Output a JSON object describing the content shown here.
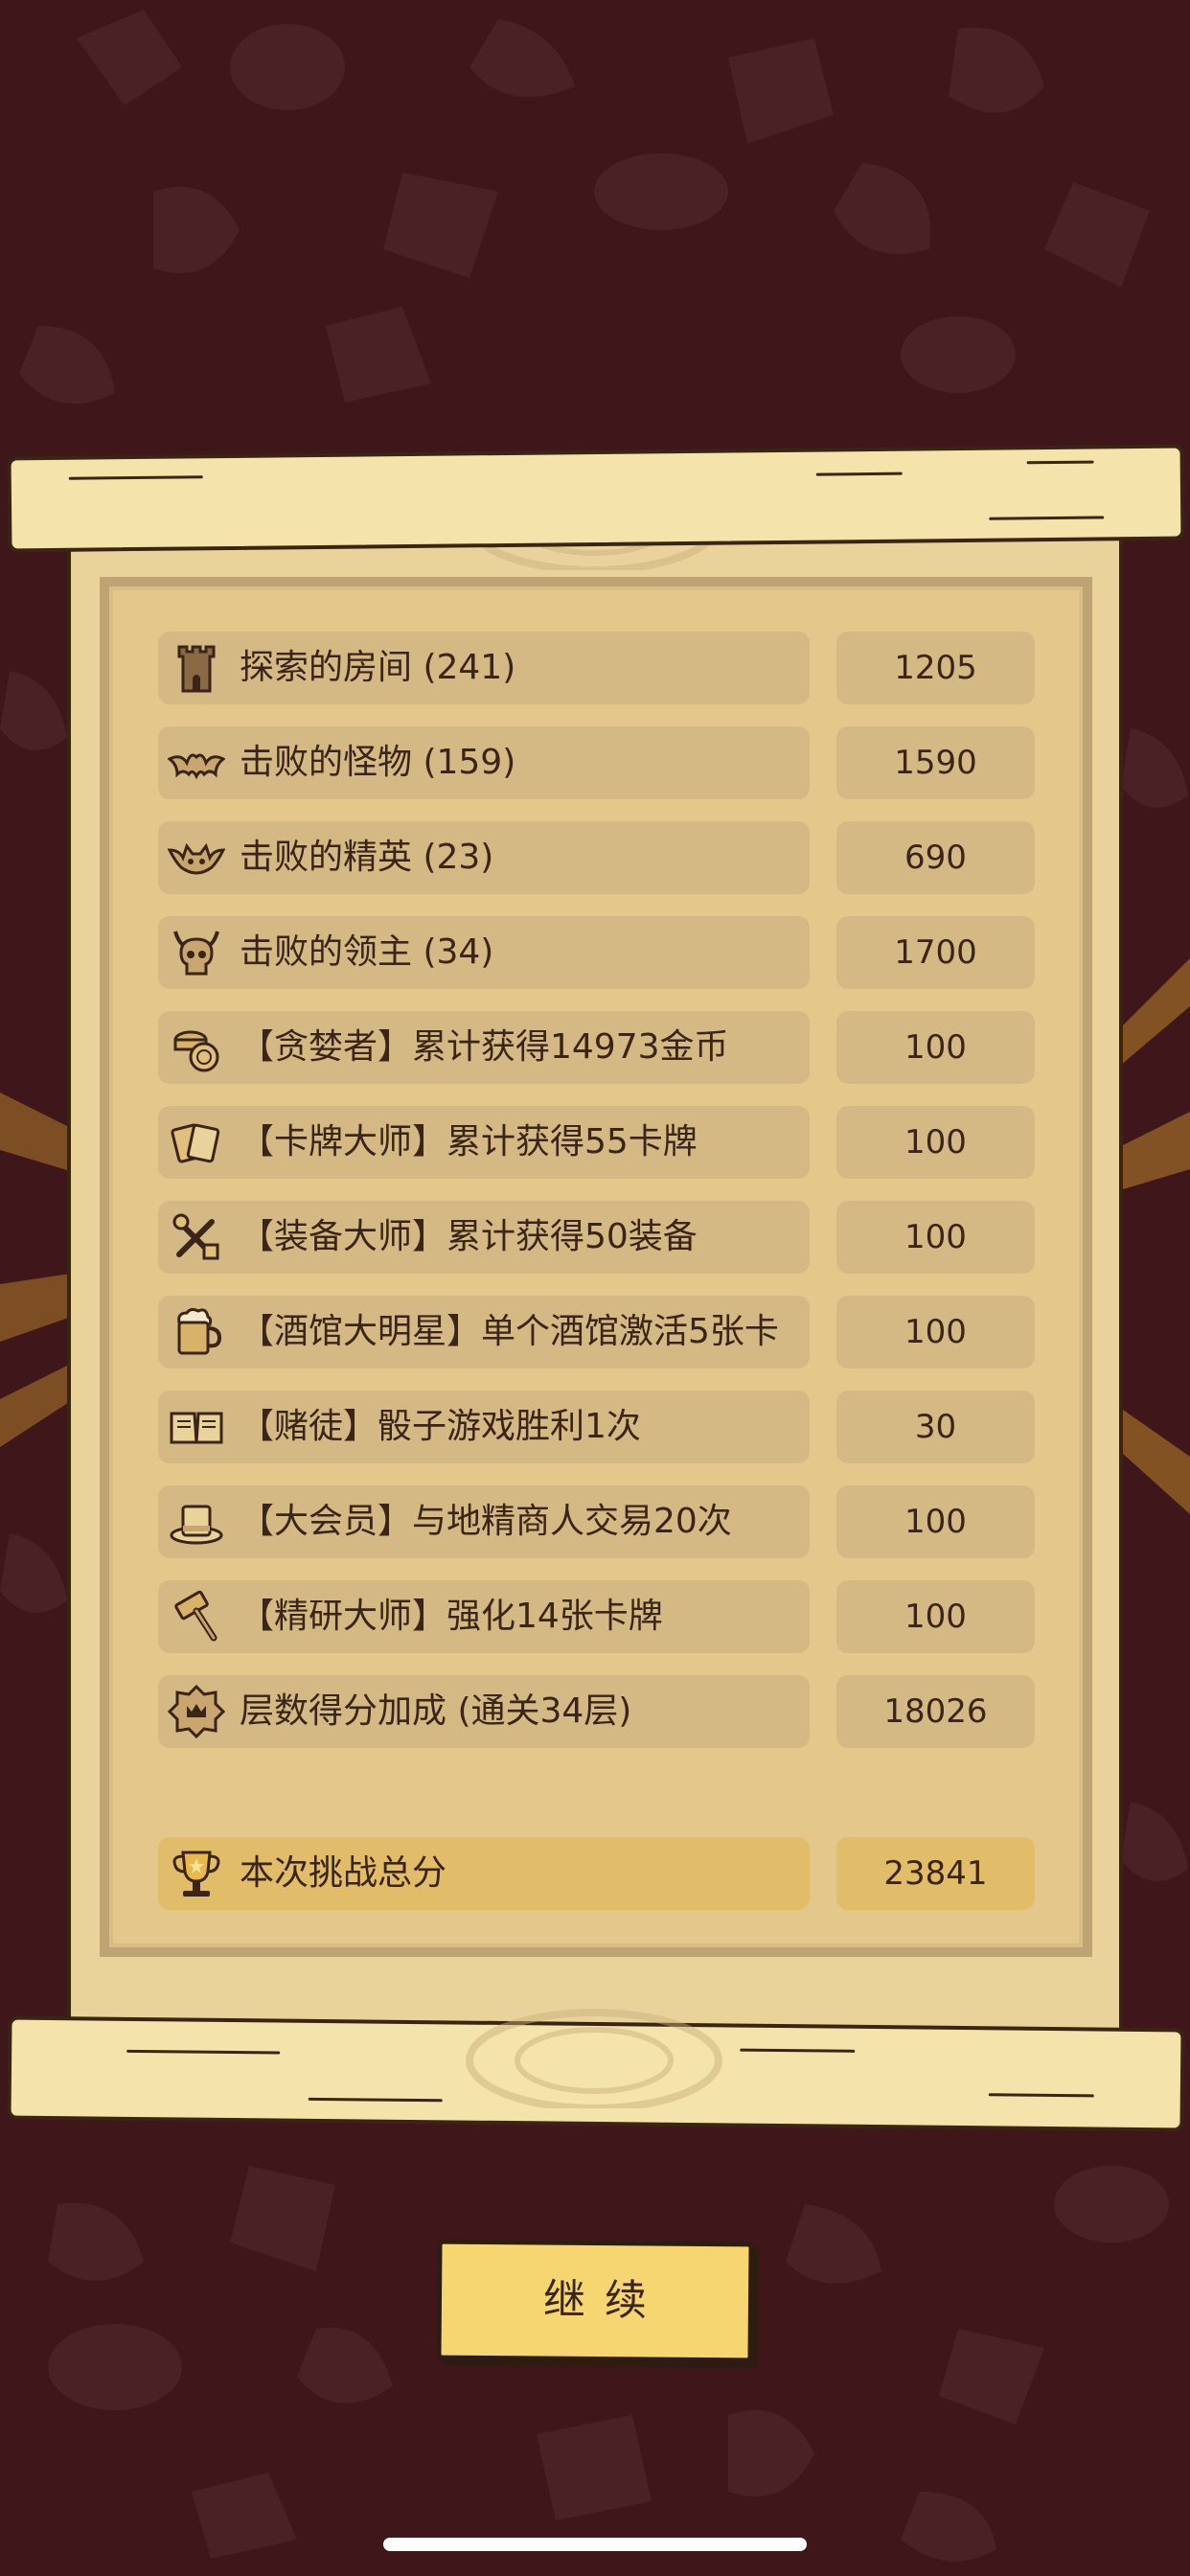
{
  "colors": {
    "background": "#3f171b",
    "parchment": "#e9d39b",
    "row_fill": "#d5b985",
    "total_fill": "#e2bd69",
    "button_fill": "#f6d670",
    "text": "#3b2418"
  },
  "score_rows": [
    {
      "icon": "tower-icon",
      "label": "探索的房间 (241)",
      "value": "1205"
    },
    {
      "icon": "bat-icon",
      "label": "击败的怪物 (159)",
      "value": "1590"
    },
    {
      "icon": "demon-bat-icon",
      "label": "击败的精英 (23)",
      "value": "690"
    },
    {
      "icon": "horned-skull-icon",
      "label": "击败的领主 (34)",
      "value": "1700"
    },
    {
      "icon": "coins-icon",
      "label": "【贪婪者】累计获得14973金币",
      "value": "100"
    },
    {
      "icon": "cards-icon",
      "label": "【卡牌大师】累计获得55卡牌",
      "value": "100"
    },
    {
      "icon": "crossed-tools-icon",
      "label": "【装备大师】累计获得50装备",
      "value": "100"
    },
    {
      "icon": "beer-mug-icon",
      "label": "【酒馆大明星】单个酒馆激活5张卡",
      "value": "100"
    },
    {
      "icon": "open-book-icon",
      "label": "【赌徒】骰子游戏胜利1次",
      "value": "30"
    },
    {
      "icon": "top-hat-icon",
      "label": "【大会员】与地精商人交易20次",
      "value": "100"
    },
    {
      "icon": "hammer-icon",
      "label": "【精研大师】强化14张卡牌",
      "value": "100"
    },
    {
      "icon": "floor-badge-icon",
      "label": "层数得分加成 (通关34层)",
      "value": "18026"
    }
  ],
  "total": {
    "icon": "trophy-icon",
    "label": "本次挑战总分",
    "value": "23841"
  },
  "continue_button": {
    "label": "继续"
  }
}
